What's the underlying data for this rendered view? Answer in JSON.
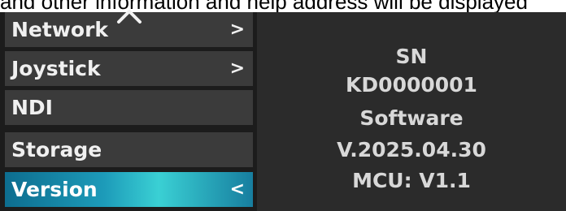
{
  "caption": "and other information and help address will be displayed",
  "menu": {
    "scroll_up_icon": "chevron-up-icon",
    "items": [
      {
        "label": "Network",
        "arrow": ">"
      },
      {
        "label": "Joystick",
        "arrow": ">"
      },
      {
        "label": "NDI",
        "arrow": ""
      },
      {
        "label": "Storage",
        "arrow": ""
      },
      {
        "label": "Version",
        "arrow": "<"
      }
    ],
    "active_index": 4
  },
  "info": {
    "sn_label": "SN",
    "sn_value": "KD0000001",
    "software_label": "Software",
    "software_value": "V.2025.04.30",
    "mcu": "MCU: V1.1"
  },
  "colors": {
    "menu_bg": "#3b3b3b",
    "active_start": "#0d6d8f",
    "active_mid": "#3ad0d4",
    "panel_bg": "#2b2b2b",
    "text": "#d8d8d8"
  }
}
